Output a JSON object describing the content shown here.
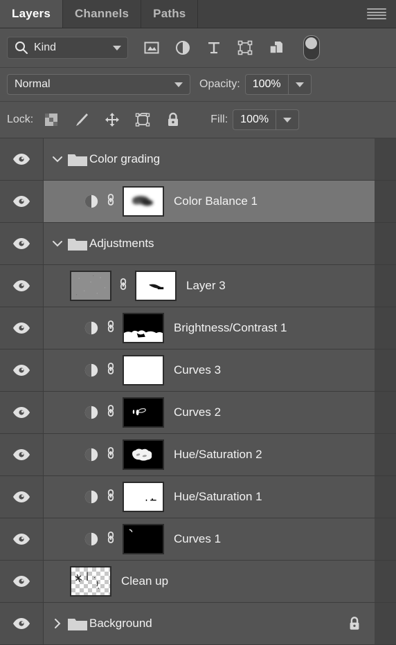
{
  "panel": {
    "title": "Layers",
    "menu_icon": "hamburger-menu-icon",
    "tabs": [
      {
        "label": "Layers",
        "active": true
      },
      {
        "label": "Channels",
        "active": false
      },
      {
        "label": "Paths",
        "active": false
      }
    ]
  },
  "filter": {
    "search_icon": "magnifier-icon",
    "kind_label": "Kind",
    "dropdown_icon": "chevron-down-icon",
    "type_filters": [
      {
        "name": "pixel-layer-filter-icon",
        "title": "Pixel layers"
      },
      {
        "name": "adjustment-layer-filter-icon",
        "title": "Adjustment layers"
      },
      {
        "name": "type-layer-filter-icon",
        "title": "Type layers"
      },
      {
        "name": "shape-layer-filter-icon",
        "title": "Shape layers"
      },
      {
        "name": "smart-object-filter-icon",
        "title": "Smart objects"
      }
    ],
    "toggle_name": "filter-enable-toggle"
  },
  "blend": {
    "mode": "Normal",
    "mode_dropdown_icon": "chevron-down-icon",
    "opacity_label": "Opacity:",
    "opacity_value": "100%",
    "opacity_stepper_icon": "chevron-down-icon"
  },
  "lock": {
    "label": "Lock:",
    "fill_label": "Fill:",
    "fill_value": "100%",
    "fill_stepper_icon": "chevron-down-icon",
    "buttons": [
      {
        "name": "lock-transparent-pixels-icon",
        "title": "Lock transparent pixels"
      },
      {
        "name": "lock-image-pixels-icon",
        "title": "Lock image pixels"
      },
      {
        "name": "lock-position-icon",
        "title": "Lock position"
      },
      {
        "name": "lock-artboard-nesting-icon",
        "title": "Prevent auto-nesting"
      },
      {
        "name": "lock-all-icon",
        "title": "Lock all"
      }
    ]
  },
  "colors": {
    "panel_bg": "#535353",
    "tabbar_bg": "#414141",
    "row_bg": "#545454",
    "row_selected_bg": "#767676",
    "eye_col_bg": "#4f4f4f",
    "gutter_bg": "#444444",
    "text": "#f2f2f2",
    "muted_text": "#b9b9b9",
    "field_bg": "#4c4c4c",
    "field_border": "#6a6a6a"
  },
  "layers": [
    {
      "name": "Color grading",
      "type": "group",
      "visible": true,
      "expanded": true,
      "indent": 0,
      "selected": false,
      "locked": false
    },
    {
      "name": "Color Balance 1",
      "type": "adjustment",
      "visible": true,
      "indent": 1,
      "selected": true,
      "locked": false,
      "linked": true,
      "mask": "blob-dark-on-white"
    },
    {
      "name": "Adjustments",
      "type": "group",
      "visible": true,
      "expanded": true,
      "indent": 0,
      "selected": false,
      "locked": false
    },
    {
      "name": "Layer 3",
      "type": "pixel",
      "visible": true,
      "indent": 1,
      "selected": false,
      "locked": false,
      "linked": true,
      "thumb": "gray-noise",
      "mask": "small-dark-streak-on-white"
    },
    {
      "name": "Brightness/Contrast 1",
      "type": "adjustment",
      "visible": true,
      "indent": 1,
      "selected": false,
      "locked": false,
      "linked": true,
      "mask": "white-bottom-band-on-black"
    },
    {
      "name": "Curves 3",
      "type": "adjustment",
      "visible": true,
      "indent": 1,
      "selected": false,
      "locked": false,
      "linked": true,
      "mask": "all-white"
    },
    {
      "name": "Curves 2",
      "type": "adjustment",
      "visible": true,
      "indent": 1,
      "selected": false,
      "locked": false,
      "linked": true,
      "mask": "small-white-marks-on-black"
    },
    {
      "name": "Hue/Saturation 2",
      "type": "adjustment",
      "visible": true,
      "indent": 1,
      "selected": false,
      "locked": false,
      "linked": true,
      "mask": "white-cloud-on-black"
    },
    {
      "name": "Hue/Saturation 1",
      "type": "adjustment",
      "visible": true,
      "indent": 1,
      "selected": false,
      "locked": false,
      "linked": true,
      "mask": "tiny-dark-marks-on-white"
    },
    {
      "name": "Curves 1",
      "type": "adjustment",
      "visible": true,
      "indent": 1,
      "selected": false,
      "locked": false,
      "linked": true,
      "mask": "tiny-white-mark-on-black"
    },
    {
      "name": "Clean up",
      "type": "pixel",
      "visible": true,
      "indent": 1,
      "selected": false,
      "locked": false,
      "linked": false,
      "thumb": "transparent-checker"
    },
    {
      "name": "Background",
      "type": "group",
      "visible": true,
      "expanded": false,
      "indent": 0,
      "selected": false,
      "locked": true,
      "lock_icon": "padlock-icon"
    }
  ]
}
